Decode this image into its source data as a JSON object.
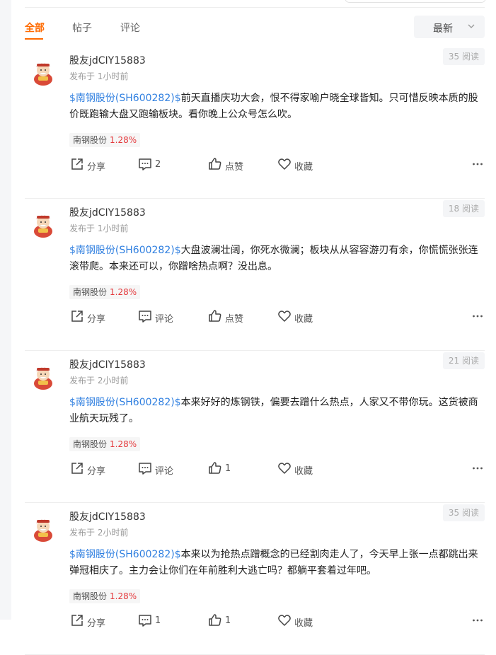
{
  "tabs": [
    {
      "label": "全部",
      "active": true
    },
    {
      "label": "帖子",
      "active": false
    },
    {
      "label": "评论",
      "active": false
    }
  ],
  "sort": {
    "label": "最新"
  },
  "colors": {
    "accent": "#ff6a00",
    "link": "#2f7fe0",
    "up": "#e4393c"
  },
  "posts": [
    {
      "username": "股友jdCIY15883",
      "time": "发布于 1小时前",
      "reads": "35 阅读",
      "stock": "$南钢股份(SH600282)$",
      "text": "前天直播庆功大会，恨不得家喻户晓全球皆知。只可惜反映本质的股价既跑输大盘又跑输板块。看你晚上公众号怎么吹。",
      "tag_name": "南钢股份",
      "tag_change": "1.28%",
      "share": "分享",
      "comment": "2",
      "like": "点赞",
      "fav": "收藏"
    },
    {
      "username": "股友jdCIY15883",
      "time": "发布于 1小时前",
      "reads": "18 阅读",
      "stock": "$南钢股份(SH600282)$",
      "text": "大盘波澜壮阔，你死水微澜；板块从从容容游刃有余，你慌慌张张连滚带爬。本来还可以，你蹭啥热点啊？没出息。",
      "tag_name": "南钢股份",
      "tag_change": "1.28%",
      "share": "分享",
      "comment": "评论",
      "like": "点赞",
      "fav": "收藏"
    },
    {
      "username": "股友jdCIY15883",
      "time": "发布于 2小时前",
      "reads": "21 阅读",
      "stock": "$南钢股份(SH600282)$",
      "text": "本来好好的炼钢铁，偏要去蹭什么热点，人家又不带你玩。这货被商业航天玩残了。",
      "tag_name": "南钢股份",
      "tag_change": "1.28%",
      "share": "分享",
      "comment": "评论",
      "like": "1",
      "fav": "收藏"
    },
    {
      "username": "股友jdCIY15883",
      "time": "发布于 2小时前",
      "reads": "35 阅读",
      "stock": "$南钢股份(SH600282)$",
      "text": "本来以为抢热点蹭概念的已经割肉走人了，今天早上张一点都跳出来弹冠相庆了。主力会让你们在年前胜利大逃亡吗？都躺平套着过年吧。",
      "tag_name": "南钢股份",
      "tag_change": "1.28%",
      "share": "分享",
      "comment": "1",
      "like": "1",
      "fav": "收藏"
    }
  ]
}
